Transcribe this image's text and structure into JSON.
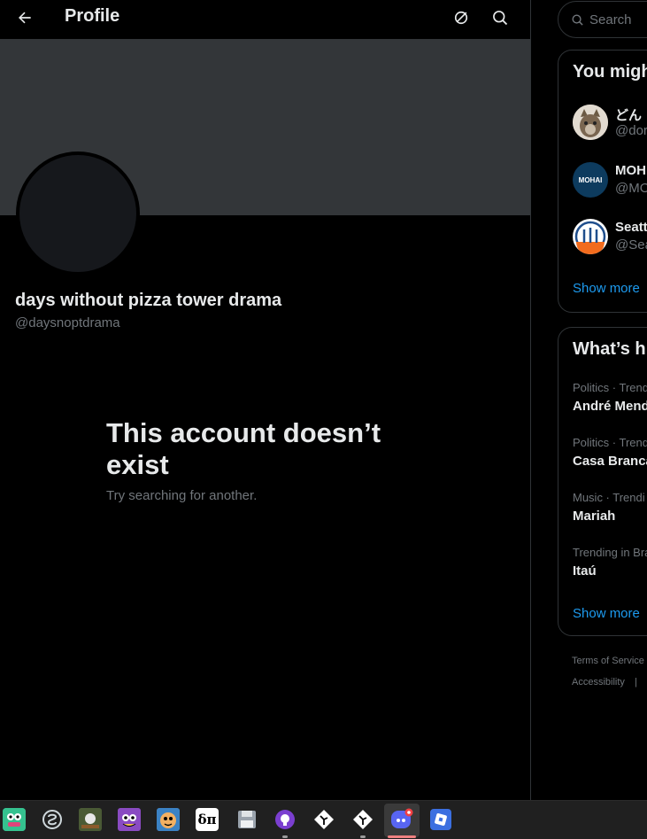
{
  "header": {
    "title": "Profile"
  },
  "profile": {
    "display_name": "days without pizza tower drama",
    "handle": "@daysnoptdrama",
    "empty_title": "This account doesn’t exist",
    "empty_subtitle": "Try searching for another."
  },
  "search": {
    "placeholder": "Search"
  },
  "who_to_follow": {
    "title": "You might",
    "items": [
      {
        "name": "どん",
        "handle": "@dor",
        "avatar": "cat-avatar"
      },
      {
        "name": "MOH",
        "handle": "@MO",
        "avatar": "mohai-logo",
        "avatar_text": "MOHAI"
      },
      {
        "name": "Seatt",
        "handle": "@Sea",
        "avatar": "seattle-seal"
      }
    ],
    "show_more": "Show more"
  },
  "trends": {
    "title": "What’s h",
    "items": [
      {
        "meta": "Politics · Trend",
        "name": "André Mend"
      },
      {
        "meta": "Politics · Trend",
        "name": "Casa Branca"
      },
      {
        "meta": "Music · Trendi",
        "name": "Mariah"
      },
      {
        "meta": "Trending in Bra",
        "name": "Itaú"
      }
    ],
    "show_more": "Show more"
  },
  "footer": {
    "links": [
      "Terms of Service",
      "Accessibility",
      "|"
    ]
  },
  "taskbar": {
    "apps": [
      {
        "name": "app-mascot-icon",
        "glyph": ""
      },
      {
        "name": "steam-style-icon",
        "glyph": "S"
      },
      {
        "name": "game-icon",
        "glyph": ""
      },
      {
        "name": "pizza-tower-icon",
        "glyph": ""
      },
      {
        "name": "character-icon",
        "glyph": ""
      },
      {
        "name": "delta-pi-icon",
        "glyph": "δπ"
      },
      {
        "name": "floppy-disk-icon",
        "glyph": ""
      },
      {
        "name": "github-icon",
        "glyph": ""
      },
      {
        "name": "git-tool-icon",
        "glyph": ""
      },
      {
        "name": "git-tool-2-icon",
        "glyph": ""
      },
      {
        "name": "discord-icon",
        "glyph": ""
      },
      {
        "name": "roblox-icon",
        "glyph": ""
      }
    ]
  },
  "colors": {
    "background": "#000000",
    "banner": "#333639",
    "accent": "#1d9bf0",
    "muted_text": "#71767b",
    "primary_text": "#e7e9ea"
  }
}
